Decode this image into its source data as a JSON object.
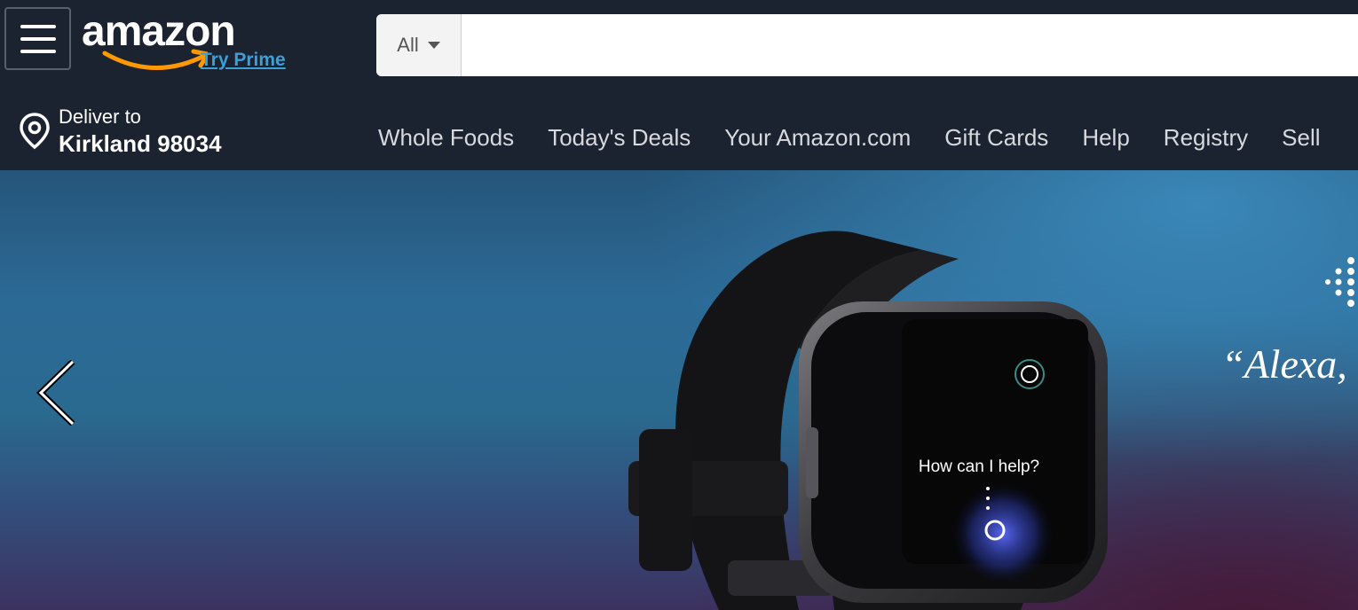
{
  "header": {
    "logo_text": "amazon",
    "prime_link": "Try Prime",
    "search": {
      "category": "All",
      "placeholder": "",
      "value": ""
    }
  },
  "subnav": {
    "deliver_label": "Deliver to",
    "deliver_location": "Kirkland 98034",
    "links": [
      "Whole Foods",
      "Today's Deals",
      "Your Amazon.com",
      "Gift Cards",
      "Help",
      "Registry",
      "Sell"
    ]
  },
  "hero": {
    "watch_prompt": "How can I help?",
    "quote": "“Alexa,"
  },
  "colors": {
    "header_bg": "#1b2230",
    "prime_link": "#3b9fd8",
    "smile": "#f90"
  }
}
